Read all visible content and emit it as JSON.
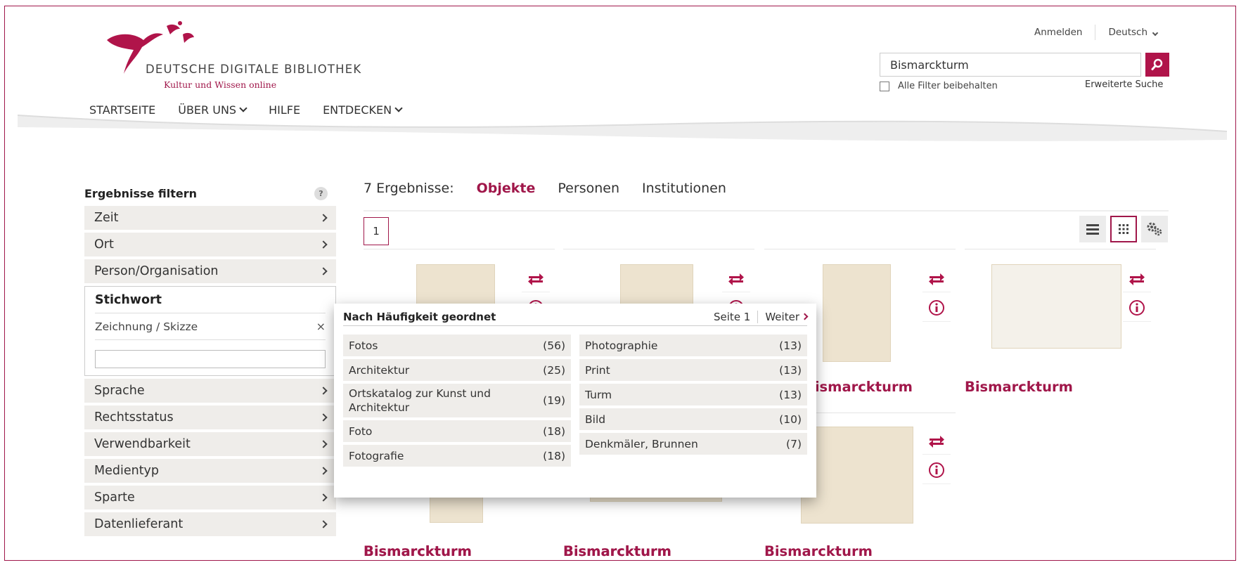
{
  "site": {
    "logo_title": "DEUTSCHE DIGITALE BIBLIOTHEK",
    "logo_subtitle": "Kultur und Wissen online"
  },
  "nav": {
    "items": [
      {
        "label": "STARTSEITE"
      },
      {
        "label": "ÜBER UNS"
      },
      {
        "label": "HILFE"
      },
      {
        "label": "ENTDECKEN"
      }
    ]
  },
  "account": {
    "login": "Anmelden",
    "language": "Deutsch"
  },
  "search": {
    "value": "Bismarckturm",
    "keep_filters": "Alle Filter beibehalten",
    "advanced": "Erweiterte Suche"
  },
  "sidebar": {
    "title": "Ergebnisse filtern",
    "help": "?",
    "facets_before": [
      "Zeit",
      "Ort",
      "Person/Organisation"
    ],
    "open_facet": {
      "title": "Stichwort",
      "selected": "Zeichnung / Skizze",
      "remove": "×"
    },
    "facets_after": [
      "Sprache",
      "Rechtsstatus",
      "Verwendbarkeit",
      "Medientyp",
      "Sparte",
      "Datenlieferant"
    ]
  },
  "results": {
    "count_label": "7 Ergebnisse:",
    "tabs": [
      "Objekte",
      "Personen",
      "Institutionen"
    ],
    "page": "1",
    "items": [
      {
        "title": "Bismarckturm"
      },
      {
        "title": "Bismarckturm"
      },
      {
        "title": "Bismarckturm"
      },
      {
        "title": "Bismarckturm"
      },
      {
        "title": "Bismarckturm"
      },
      {
        "title": "Bismarckturm"
      },
      {
        "title": "Bismarckturm"
      }
    ]
  },
  "popup": {
    "heading": "Nach Häufigkeit geordnet",
    "page": "Seite 1",
    "next": "Weiter",
    "left": [
      {
        "label": "Fotos",
        "count": "(56)"
      },
      {
        "label": "Architektur",
        "count": "(25)"
      },
      {
        "label": "Ortskatalog zur Kunst und Architektur",
        "count": "(19)"
      },
      {
        "label": "Foto",
        "count": "(18)"
      },
      {
        "label": "Fotografie",
        "count": "(18)"
      }
    ],
    "right": [
      {
        "label": "Photographie",
        "count": "(13)"
      },
      {
        "label": "Print",
        "count": "(13)"
      },
      {
        "label": "Turm",
        "count": "(13)"
      },
      {
        "label": "Bild",
        "count": "(10)"
      },
      {
        "label": "Denkmäler, Brunnen",
        "count": "(7)"
      }
    ]
  },
  "colors": {
    "accent": "#a0174a",
    "facet_bg": "#efedea"
  }
}
